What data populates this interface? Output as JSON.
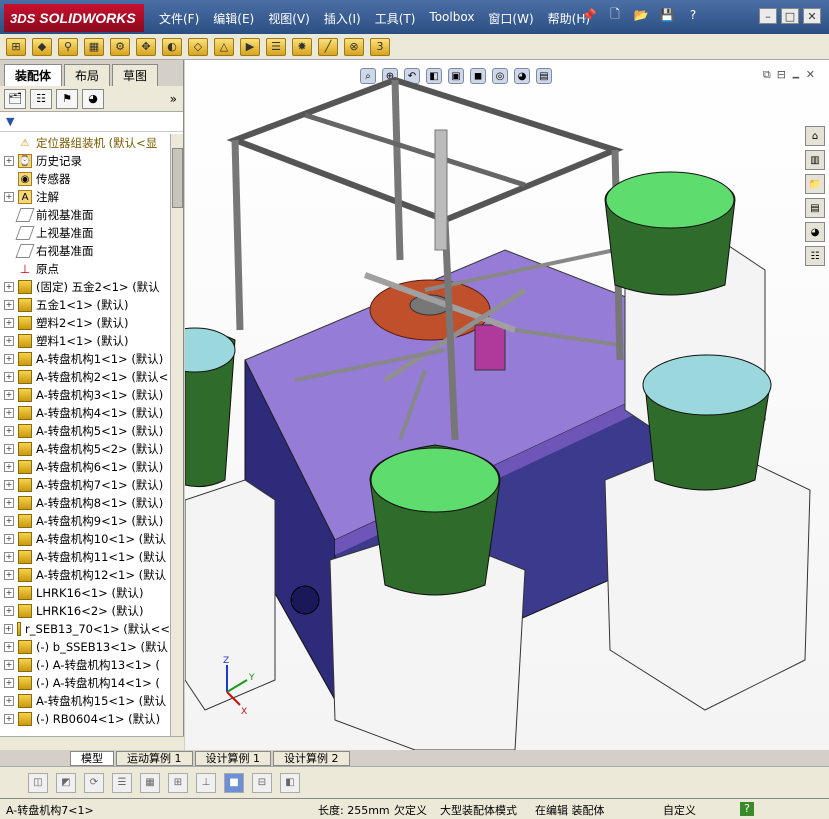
{
  "app": {
    "brand_prefix": "3DS",
    "brand": "SOLIDWORKS"
  },
  "menu": [
    "文件(F)",
    "编辑(E)",
    "视图(V)",
    "插入(I)",
    "工具(T)",
    "Toolbox",
    "窗口(W)",
    "帮助(H)"
  ],
  "panel": {
    "tabs": [
      "装配体",
      "布局",
      "草图"
    ],
    "active_tab": "装配体",
    "filter_label": "▼"
  },
  "tree": {
    "root": "定位器组装机  (默认<显",
    "items": [
      {
        "label": "历史记录",
        "icon": "history-icon",
        "exp": "+"
      },
      {
        "label": "传感器",
        "icon": "sensor-icon",
        "exp": ""
      },
      {
        "label": "注解",
        "icon": "annotation-icon",
        "exp": "+"
      },
      {
        "label": "前视基准面",
        "icon": "plane-icon",
        "exp": ""
      },
      {
        "label": "上视基准面",
        "icon": "plane-icon",
        "exp": ""
      },
      {
        "label": "右视基准面",
        "icon": "plane-icon",
        "exp": ""
      },
      {
        "label": "原点",
        "icon": "origin-icon",
        "exp": ""
      },
      {
        "label": "(固定) 五金2<1> (默认",
        "icon": "component-icon",
        "exp": "+"
      },
      {
        "label": "五金1<1> (默认)",
        "icon": "component-icon",
        "exp": "+"
      },
      {
        "label": "塑料2<1> (默认)",
        "icon": "component-icon",
        "exp": "+"
      },
      {
        "label": "塑料1<1> (默认)",
        "icon": "component-icon",
        "exp": "+"
      },
      {
        "label": "A-转盘机构1<1> (默认)",
        "icon": "component-icon",
        "exp": "+"
      },
      {
        "label": "A-转盘机构2<1> (默认<",
        "icon": "component-icon",
        "exp": "+"
      },
      {
        "label": "A-转盘机构3<1> (默认)",
        "icon": "component-icon",
        "exp": "+"
      },
      {
        "label": "A-转盘机构4<1> (默认)",
        "icon": "component-icon",
        "exp": "+"
      },
      {
        "label": "A-转盘机构5<1> (默认)",
        "icon": "component-icon",
        "exp": "+"
      },
      {
        "label": "A-转盘机构5<2> (默认)",
        "icon": "component-icon",
        "exp": "+"
      },
      {
        "label": "A-转盘机构6<1> (默认)",
        "icon": "component-icon",
        "exp": "+"
      },
      {
        "label": "A-转盘机构7<1> (默认)",
        "icon": "component-icon",
        "exp": "+"
      },
      {
        "label": "A-转盘机构8<1> (默认)",
        "icon": "component-icon",
        "exp": "+"
      },
      {
        "label": "A-转盘机构9<1> (默认)",
        "icon": "component-icon",
        "exp": "+"
      },
      {
        "label": "A-转盘机构10<1> (默认",
        "icon": "component-icon",
        "exp": "+"
      },
      {
        "label": "A-转盘机构11<1> (默认",
        "icon": "component-icon",
        "exp": "+"
      },
      {
        "label": "A-转盘机构12<1> (默认",
        "icon": "component-icon",
        "exp": "+"
      },
      {
        "label": "LHRK16<1> (默认)",
        "icon": "component-icon",
        "exp": "+"
      },
      {
        "label": "LHRK16<2> (默认)",
        "icon": "component-icon",
        "exp": "+"
      },
      {
        "label": "r_SEB13_70<1> (默认<<",
        "icon": "component-icon",
        "exp": "+"
      },
      {
        "label": "(-) b_SSEB13<1> (默认",
        "icon": "component-icon",
        "exp": "+"
      },
      {
        "label": "(-) A-转盘机构13<1> (",
        "icon": "component-icon",
        "exp": "+"
      },
      {
        "label": "(-) A-转盘机构14<1> (",
        "icon": "component-icon",
        "exp": "+"
      },
      {
        "label": "A-转盘机构15<1> (默认",
        "icon": "component-icon",
        "exp": "+"
      },
      {
        "label": "(-) RB0604<1> (默认)",
        "icon": "component-icon",
        "exp": "+"
      }
    ]
  },
  "bottom_tabs": [
    "模型",
    "运动算例 1",
    "设计算例 1",
    "设计算例 2"
  ],
  "active_bottom_tab": "模型",
  "status": {
    "selection": "A-转盘机构7<1>",
    "length": "长度: 255mm",
    "defined": "欠定义",
    "mode": "大型装配体模式",
    "editing": "在编辑 装配体",
    "units": "自定义",
    "help": "?"
  },
  "colors": {
    "frame": "#3c3a8c",
    "table_top": "#8b6fd4",
    "bowl_green": "#2f6b2a",
    "bowl_liquid": "#5fdc6e",
    "bowl_blue_liquid": "#9ad8dd",
    "stand_white": "#f4f4f4"
  }
}
